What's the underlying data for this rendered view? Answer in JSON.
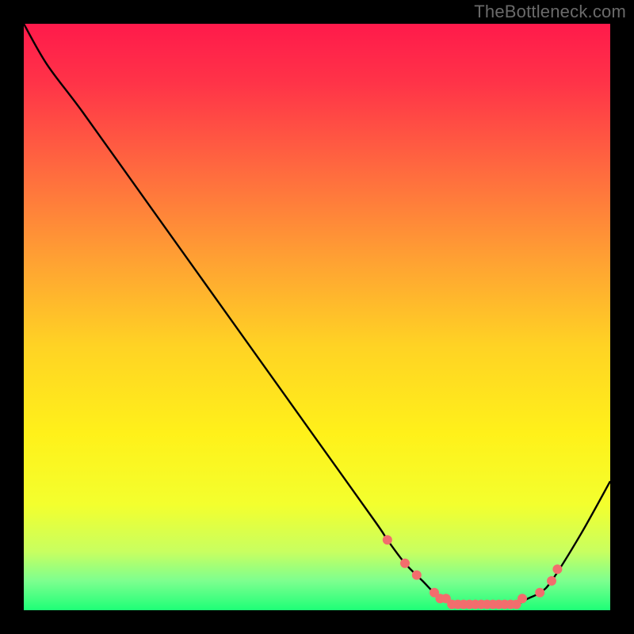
{
  "watermark": "TheBottleneck.com",
  "colors": {
    "bg": "#000000",
    "curve": "#000000",
    "markers": "#f26d6d",
    "watermark": "#6a6a6a"
  },
  "gradient_stops": [
    {
      "offset": 0.0,
      "color": "#ff1a4b"
    },
    {
      "offset": 0.1,
      "color": "#ff3348"
    },
    {
      "offset": 0.25,
      "color": "#ff6a3f"
    },
    {
      "offset": 0.4,
      "color": "#ffa033"
    },
    {
      "offset": 0.55,
      "color": "#ffd324"
    },
    {
      "offset": 0.7,
      "color": "#fff11a"
    },
    {
      "offset": 0.82,
      "color": "#f3ff2e"
    },
    {
      "offset": 0.9,
      "color": "#c8ff60"
    },
    {
      "offset": 0.95,
      "color": "#7dff8f"
    },
    {
      "offset": 1.0,
      "color": "#1eff77"
    }
  ],
  "chart_data": {
    "type": "line",
    "title": "",
    "xlabel": "",
    "ylabel": "",
    "xlim": [
      0,
      100
    ],
    "ylim": [
      0,
      100
    ],
    "series": [
      {
        "name": "bottleneck-curve",
        "x": [
          0,
          4,
          10,
          20,
          30,
          40,
          50,
          60,
          62,
          65,
          68,
          70,
          72,
          74,
          76,
          78,
          80,
          82,
          84,
          86,
          88,
          90,
          95,
          100
        ],
        "values": [
          100,
          93,
          85,
          71,
          57,
          43,
          29,
          15,
          12,
          8,
          5,
          3,
          2,
          1,
          1,
          1,
          1,
          1,
          1,
          2,
          3,
          5,
          13,
          22
        ]
      }
    ],
    "markers": {
      "name": "highlight-points",
      "x": [
        62,
        65,
        67,
        70,
        71,
        72,
        73,
        74,
        75,
        76,
        77,
        78,
        79,
        80,
        81,
        82,
        83,
        84,
        85,
        88,
        90,
        91
      ],
      "values": [
        12,
        8,
        6,
        3,
        2,
        2,
        1,
        1,
        1,
        1,
        1,
        1,
        1,
        1,
        1,
        1,
        1,
        1,
        2,
        3,
        5,
        7
      ]
    }
  }
}
